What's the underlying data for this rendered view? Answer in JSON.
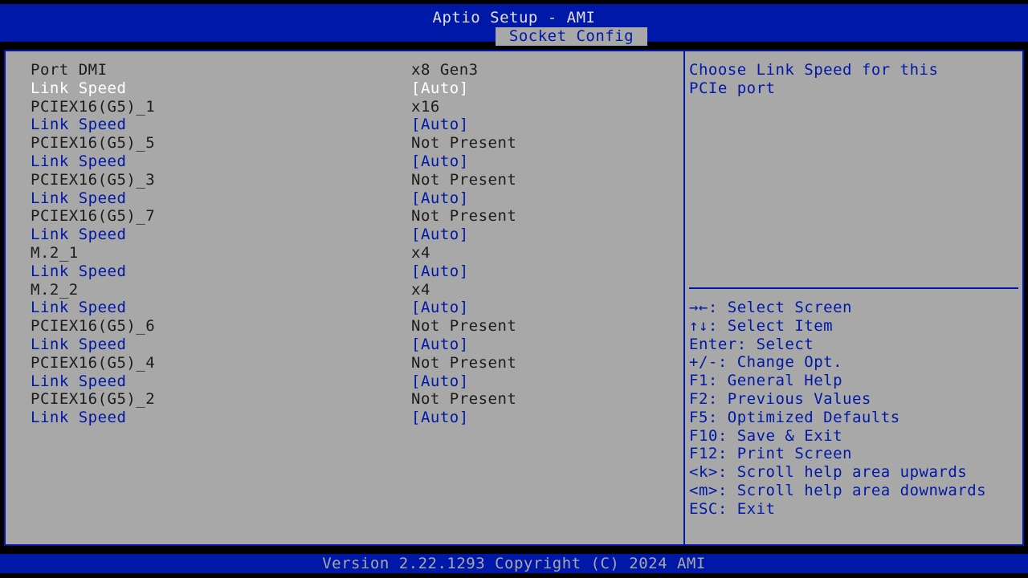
{
  "header": {
    "title": "Aptio Setup - AMI",
    "tab": "Socket Config"
  },
  "rows": [
    {
      "label": "Port DMI",
      "value": "x8 Gen3",
      "type": "info"
    },
    {
      "label": "Link Speed",
      "value": "[Auto]",
      "type": "selected"
    },
    {
      "label": "PCIEX16(G5)_1",
      "value": "x16",
      "type": "info"
    },
    {
      "label": "Link Speed",
      "value": "[Auto]",
      "type": "option"
    },
    {
      "label": "PCIEX16(G5)_5",
      "value": "Not Present",
      "type": "info"
    },
    {
      "label": "Link Speed",
      "value": "[Auto]",
      "type": "option"
    },
    {
      "label": "PCIEX16(G5)_3",
      "value": "Not Present",
      "type": "info"
    },
    {
      "label": "Link Speed",
      "value": "[Auto]",
      "type": "option"
    },
    {
      "label": "PCIEX16(G5)_7",
      "value": "Not Present",
      "type": "info"
    },
    {
      "label": "Link Speed",
      "value": "[Auto]",
      "type": "option"
    },
    {
      "label": "M.2_1",
      "value": "x4",
      "type": "info"
    },
    {
      "label": "Link Speed",
      "value": "[Auto]",
      "type": "option"
    },
    {
      "label": "M.2_2",
      "value": "x4",
      "type": "info"
    },
    {
      "label": "Link Speed",
      "value": "[Auto]",
      "type": "option"
    },
    {
      "label": "PCIEX16(G5)_6",
      "value": "Not Present",
      "type": "info"
    },
    {
      "label": "Link Speed",
      "value": "[Auto]",
      "type": "option"
    },
    {
      "label": "PCIEX16(G5)_4",
      "value": "Not Present",
      "type": "info"
    },
    {
      "label": "Link Speed",
      "value": "[Auto]",
      "type": "option"
    },
    {
      "label": "PCIEX16(G5)_2",
      "value": "Not Present",
      "type": "info"
    },
    {
      "label": "Link Speed",
      "value": "[Auto]",
      "type": "option"
    }
  ],
  "help": {
    "lines": [
      "Choose Link Speed for this",
      "PCIe port"
    ]
  },
  "keys": [
    "→←: Select Screen",
    "↑↓: Select Item",
    "Enter: Select",
    "+/-: Change Opt.",
    "F1: General Help",
    "F2: Previous Values",
    "F5: Optimized Defaults",
    "F10: Save & Exit",
    "F12: Print Screen",
    "<k>: Scroll help area upwards",
    "<m>: Scroll help area downwards",
    "ESC: Exit"
  ],
  "footer": {
    "text": "Version 2.22.1293 Copyright (C) 2024 AMI"
  },
  "colors": {
    "bios_blue": "#0018a8",
    "panel_gray": "#a8a8a8",
    "info_text": "#1c1c1c",
    "selected_text": "#ffffff"
  }
}
